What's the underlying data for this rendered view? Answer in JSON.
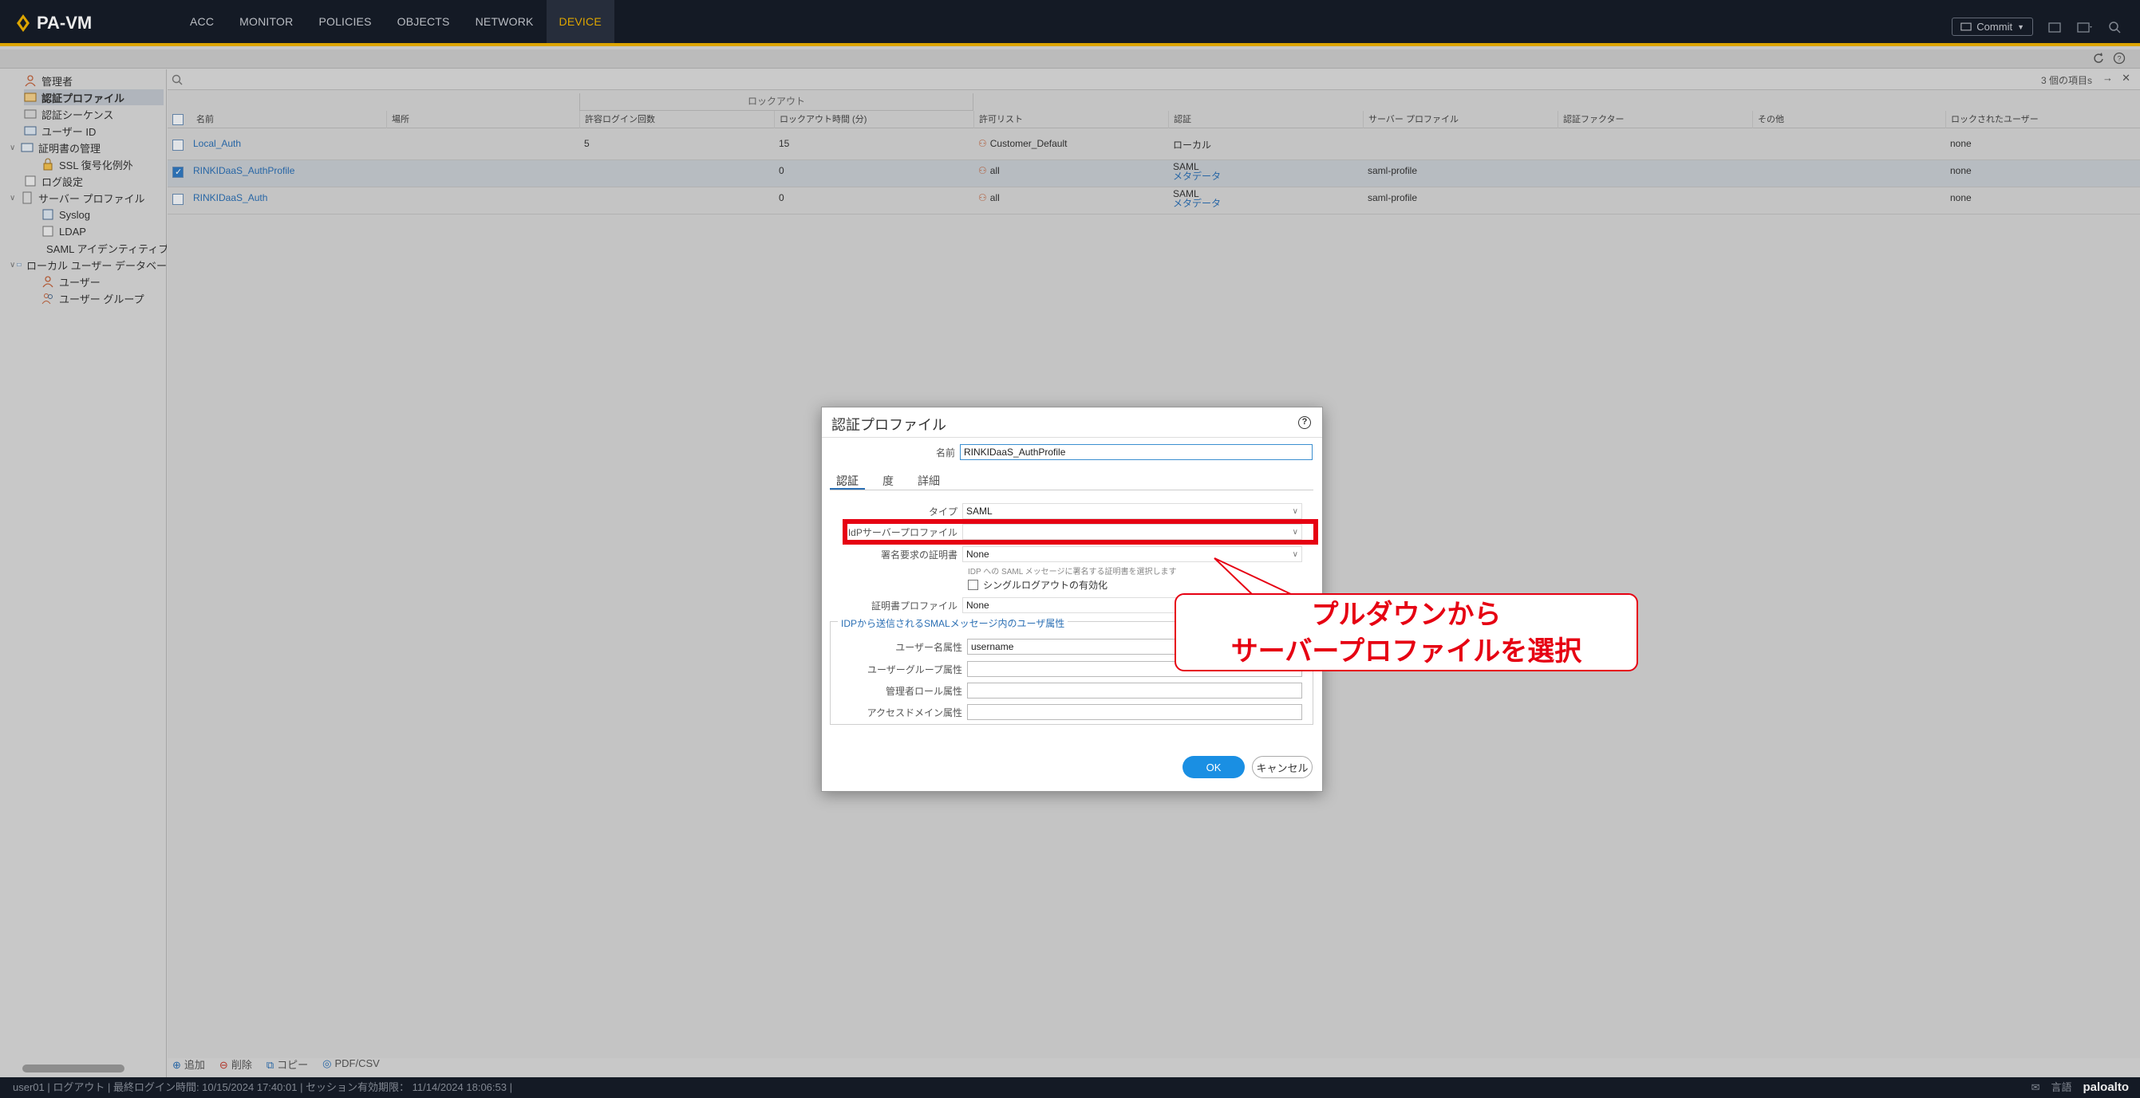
{
  "topbar": {
    "brand": "PA-VM",
    "tabs": [
      "ACC",
      "MONITOR",
      "POLICIES",
      "OBJECTS",
      "NETWORK",
      "DEVICE"
    ],
    "active_tab": "DEVICE",
    "commit_label": "Commit"
  },
  "sidebar": {
    "items": [
      {
        "label": "管理者",
        "indent": 0,
        "selected": false
      },
      {
        "label": "認証プロファイル",
        "indent": 0,
        "selected": true
      },
      {
        "label": "認証シーケンス",
        "indent": 0,
        "selected": false
      },
      {
        "label": "ユーザー ID",
        "indent": 0,
        "selected": false
      },
      {
        "label": "証明書の管理",
        "indent": 0,
        "selected": false
      },
      {
        "label": "SSL 復号化例外",
        "indent": 2,
        "selected": false
      },
      {
        "label": "ログ設定",
        "indent": 0,
        "selected": false
      },
      {
        "label": "サーバー プロファイル",
        "indent": 0,
        "selected": false
      },
      {
        "label": "Syslog",
        "indent": 1,
        "selected": false
      },
      {
        "label": "LDAP",
        "indent": 1,
        "selected": false
      },
      {
        "label": "SAML アイデンティティプ",
        "indent": 1,
        "selected": false
      },
      {
        "label": "ローカル ユーザー データベー",
        "indent": 0,
        "selected": false
      },
      {
        "label": "ユーザー",
        "indent": 1,
        "selected": false
      },
      {
        "label": "ユーザー グループ",
        "indent": 1,
        "selected": false
      }
    ]
  },
  "grid": {
    "count_text": "3 個の項目s",
    "group_header": "ロックアウト",
    "columns": [
      "名前",
      "場所",
      "許容ログイン回数",
      "ロックアウト時間 (分)",
      "許可リスト",
      "認証",
      "サーバー プロファイル",
      "認証ファクター",
      "その他",
      "ロックされたユーザー"
    ],
    "rows": [
      {
        "name": "Local_Auth",
        "location": "",
        "attempts": "5",
        "lockout": "15",
        "allow": "Customer_Default",
        "auth": "ローカル",
        "auth_sub": "",
        "server": "",
        "factor": "",
        "other": "",
        "locked": "none",
        "selected": false
      },
      {
        "name": "RINKIDaaS_AuthProfile",
        "location": "",
        "attempts": "",
        "lockout": "0",
        "allow": "all",
        "auth": "SAML",
        "auth_sub": "メタデータ",
        "server": "saml-profile",
        "factor": "",
        "other": "",
        "locked": "none",
        "selected": true
      },
      {
        "name": "RINKIDaaS_Auth",
        "location": "",
        "attempts": "",
        "lockout": "0",
        "allow": "all",
        "auth": "SAML",
        "auth_sub": "メタデータ",
        "server": "saml-profile",
        "factor": "",
        "other": "",
        "locked": "none",
        "selected": false
      }
    ]
  },
  "bottom_tools": {
    "add": "追加",
    "delete": "削除",
    "copy": "コピー",
    "pdf": "PDF/CSV"
  },
  "statusbar": {
    "text": "user01 | ログアウト | 最終ログイン時間: 10/15/2024 17:40:01 | セッション有効期限： 11/14/2024 18:06:53 |",
    "right_lang": "言語",
    "logo": "paloalto"
  },
  "dialog": {
    "title": "認証プロファイル",
    "name_label": "名前",
    "name_value": "RINKIDaaS_AuthProfile",
    "tabs": [
      "認証",
      "度",
      "詳細"
    ],
    "type_label": "タイプ",
    "type_value": "SAML",
    "idp_label": "IdPサーバープロファイル",
    "idp_value": "",
    "sign_label": "署名要求の証明書",
    "sign_value": "None",
    "sign_hint": "IDP への SAML メッセージに署名する証明書を選択します",
    "slo_label": "シングルログアウトの有効化",
    "certprof_label": "証明書プロファイル",
    "certprof_value": "None",
    "section_title": "IDPから送信されるSMALメッセージ内のユーザ属性",
    "username_label": "ユーザー名属性",
    "username_value": "username",
    "usergroup_label": "ユーザーグループ属性",
    "adminrole_label": "管理者ロール属性",
    "accessdomain_label": "アクセスドメイン属性",
    "ok": "OK",
    "cancel": "キャンセル"
  },
  "annotation": {
    "line1": "プルダウンから",
    "line2": "サーバープロファイルを選択",
    "color": "#e60012"
  }
}
